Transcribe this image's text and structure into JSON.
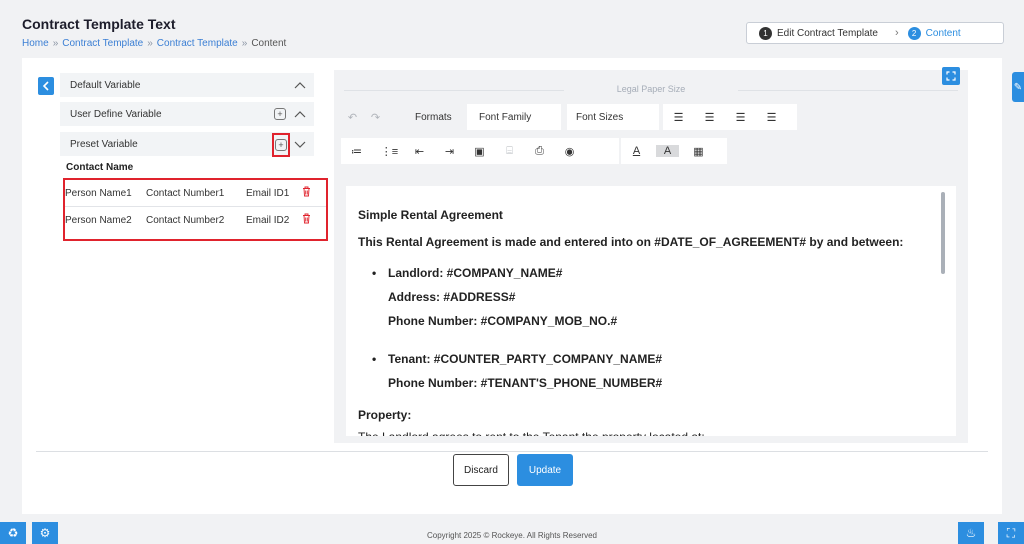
{
  "header": {
    "title": "Contract Template Text",
    "breadcrumb": [
      "Home",
      "Contract Template",
      "Contract Template",
      "Content"
    ],
    "breadcrumb_sep": "»"
  },
  "stepper": {
    "step1_num": "1",
    "step1_label": "Edit Contract Template",
    "chevron": "›",
    "step2_num": "2",
    "step2_label": "Content"
  },
  "variables": {
    "default_label": "Default Variable",
    "user_label": "User Define Variable",
    "preset_label": "Preset Variable",
    "contact_title": "Contact Name",
    "rows": [
      {
        "name": "Person Name1",
        "number": "Contact Number1",
        "email": "Email ID1"
      },
      {
        "name": "Person Name2",
        "number": "Contact Number2",
        "email": "Email ID2"
      }
    ]
  },
  "editor": {
    "paper_size": "Legal Paper Size",
    "formats_label": "Formats",
    "font_family_label": "Font Family",
    "font_sizes_label": "Font Sizes"
  },
  "document": {
    "title": "Simple Rental Agreement",
    "intro": "This Rental Agreement is made and entered into on  #DATE_OF_AGREEMENT#  by and between:",
    "landlord": "Landlord:  #COMPANY_NAME#",
    "address": "Address:  #ADDRESS#",
    "landlord_phone": "Phone Number:  #COMPANY_MOB_NO.#",
    "tenant": "Tenant:  #COUNTER_PARTY_COMPANY_NAME#",
    "tenant_phone": "Phone Number:  #TENANT'S_PHONE_NUMBER#",
    "property_heading": "Property:",
    "property_text": "The Landlord agrees to rent to the Tenant the property located at:"
  },
  "actions": {
    "discard_label": "Discard",
    "update_label": "Update"
  },
  "footer": {
    "copyright": "Copyright 2025 © Rockeye. All Rights Reserved"
  },
  "colors": {
    "accent": "#2c8ee0",
    "highlight": "#e0232d"
  }
}
